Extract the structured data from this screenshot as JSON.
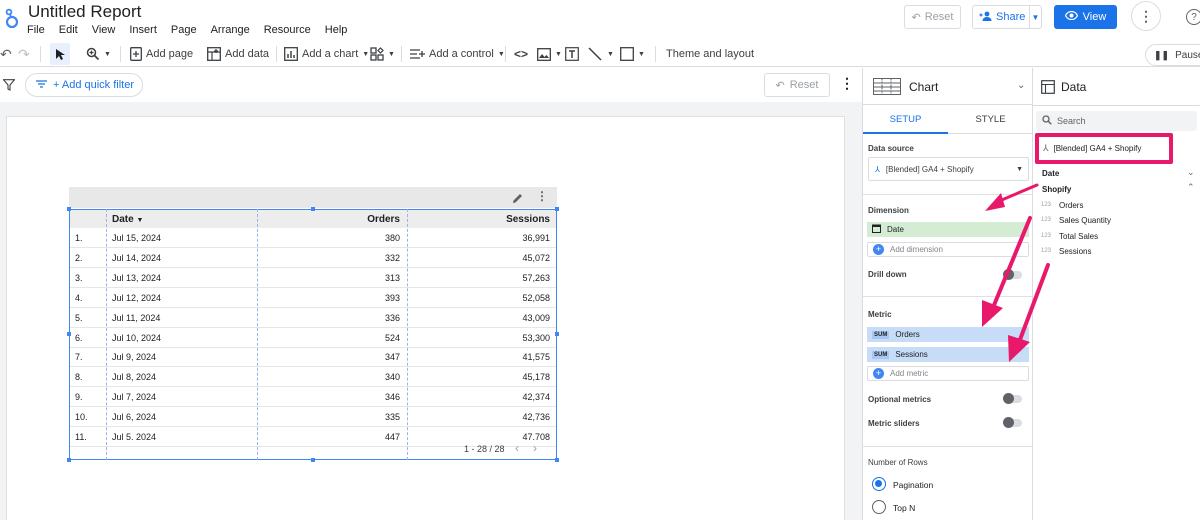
{
  "app": {
    "title": "Untitled Report",
    "menu": [
      "File",
      "Edit",
      "View",
      "Insert",
      "Page",
      "Arrange",
      "Resource",
      "Help"
    ],
    "reset_label": "Reset",
    "share_label": "Share",
    "view_label": "View"
  },
  "toolbar": {
    "add_page": "Add page",
    "add_data": "Add data",
    "add_chart": "Add a chart",
    "add_control": "Add a control",
    "theme_layout": "Theme and layout",
    "pause": "Pause u"
  },
  "filter_bar": {
    "quick_filter": "+ Add quick filter",
    "reset_label": "Reset"
  },
  "table": {
    "columns": [
      "Date",
      "Orders",
      "Sessions"
    ],
    "rows": [
      {
        "idx": "1.",
        "date": "Jul 15, 2024",
        "orders": "380",
        "sessions": "36,991"
      },
      {
        "idx": "2.",
        "date": "Jul 14, 2024",
        "orders": "332",
        "sessions": "45,072"
      },
      {
        "idx": "3.",
        "date": "Jul 13, 2024",
        "orders": "313",
        "sessions": "57,263"
      },
      {
        "idx": "4.",
        "date": "Jul 12, 2024",
        "orders": "393",
        "sessions": "52,058"
      },
      {
        "idx": "5.",
        "date": "Jul 11, 2024",
        "orders": "336",
        "sessions": "43,009"
      },
      {
        "idx": "6.",
        "date": "Jul 10, 2024",
        "orders": "524",
        "sessions": "53,300"
      },
      {
        "idx": "7.",
        "date": "Jul 9, 2024",
        "orders": "347",
        "sessions": "41,575"
      },
      {
        "idx": "8.",
        "date": "Jul 8, 2024",
        "orders": "340",
        "sessions": "45,178"
      },
      {
        "idx": "9.",
        "date": "Jul 7, 2024",
        "orders": "346",
        "sessions": "42,374"
      },
      {
        "idx": "10.",
        "date": "Jul 6, 2024",
        "orders": "335",
        "sessions": "42,736"
      },
      {
        "idx": "11.",
        "date": "Jul 5. 2024",
        "orders": "447",
        "sessions": "47.708"
      }
    ],
    "pagination": "1 - 28 / 28"
  },
  "chart_panel": {
    "title": "Chart",
    "tabs": [
      "SETUP",
      "STYLE"
    ],
    "data_source_label": "Data source",
    "data_source": "[Blended] GA4 + Shopify",
    "dimension_label": "Dimension",
    "dimension": "Date",
    "add_dimension": "Add dimension",
    "drill_down": "Drill down",
    "metric_label": "Metric",
    "metrics": [
      {
        "agg": "SUM",
        "name": "Orders"
      },
      {
        "agg": "SUM",
        "name": "Sessions"
      }
    ],
    "add_metric": "Add metric",
    "optional_metrics": "Optional metrics",
    "metric_sliders": "Metric sliders",
    "number_of_rows": "Number of Rows",
    "row_options": [
      "Pagination",
      "Top N"
    ]
  },
  "data_panel": {
    "title": "Data",
    "search_placeholder": "Search",
    "data_source": "[Blended] GA4 + Shopify",
    "groups": [
      "Date",
      "Shopify"
    ],
    "fields": [
      {
        "type": "123",
        "name": "Orders"
      },
      {
        "type": "123",
        "name": "Sales Quantity"
      },
      {
        "type": "123",
        "name": "Total Sales"
      },
      {
        "type": "123",
        "name": "Sessions"
      }
    ]
  },
  "colors": {
    "accent": "#1a73e8",
    "annotation": "#e8196b",
    "dimension_chip": "#d5ecd4",
    "metric_chip": "#c6dcf7"
  }
}
